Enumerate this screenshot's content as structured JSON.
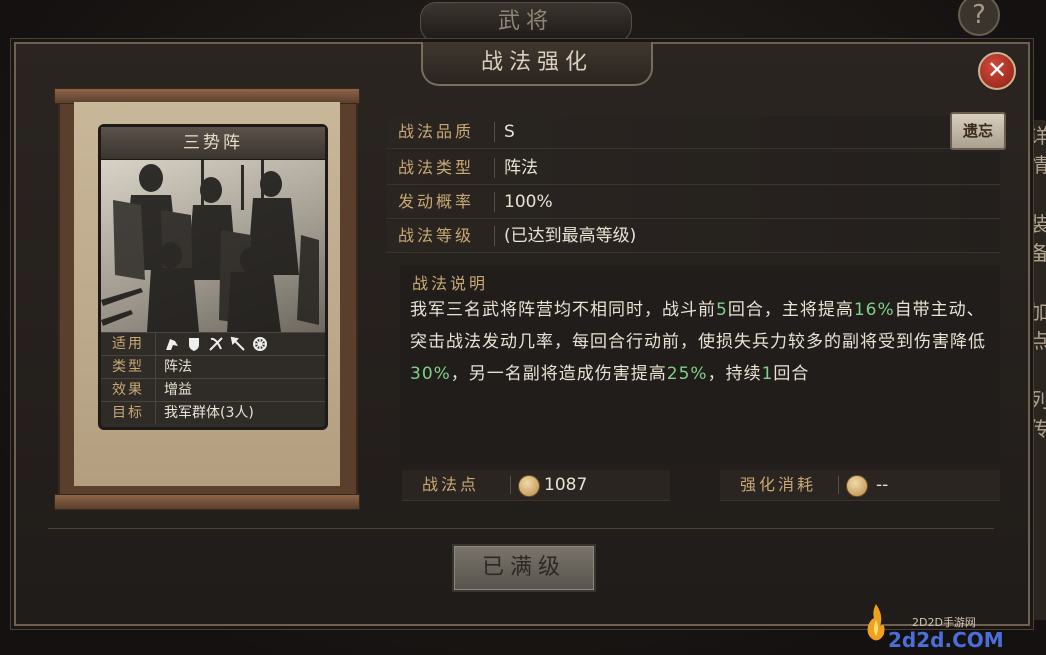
{
  "top_title": "武将",
  "help_label": "?",
  "right_strip": [
    "详情",
    "装备",
    "加点",
    "列传"
  ],
  "dialog": {
    "title": "战法强化",
    "close_label": "✕"
  },
  "card": {
    "name": "三势阵",
    "stats": {
      "applicable_key": "适用",
      "type_key": "类型",
      "type_val": "阵法",
      "effect_key": "效果",
      "effect_val": "增益",
      "target_key": "目标",
      "target_val": "我军群体(3人)"
    },
    "unit_icons": [
      "cavalry-icon",
      "shield-icon",
      "bow-icon",
      "spear-icon",
      "siege-icon"
    ]
  },
  "info": {
    "quality_key": "战法品质",
    "quality_val": "S",
    "type_key": "战法类型",
    "type_val": "阵法",
    "rate_key": "发动概率",
    "rate_val": "100%",
    "level_key": "战法等级",
    "level_val": "(已达到最高等级)",
    "forget_label": "遗忘"
  },
  "description": {
    "title": "战法说明",
    "parts": {
      "p1": "我军三名武将阵营均不相同时，战斗前",
      "n1": "5",
      "p2": "回合，主将提高",
      "n2": "16%",
      "p3": "自带主动、突击战法发动几率，每回合行动前，使损失兵力较多的副将受到伤害降低",
      "n3": "30%",
      "p4": "，另一名副将造成伤害提高",
      "n4": "25%",
      "p5": "，持续",
      "n5": "1",
      "p6": "回合"
    }
  },
  "points": {
    "key": "战法点",
    "value": "1087"
  },
  "cost": {
    "key": "强化消耗",
    "value": "--"
  },
  "max_button": "已满级",
  "watermark": {
    "small": "2D2D手游网",
    "big": "2d2d.COM"
  },
  "colors": {
    "accent_gold": "#c8a874",
    "highlight_green": "#7fd08a",
    "close_red": "#c0392b"
  }
}
